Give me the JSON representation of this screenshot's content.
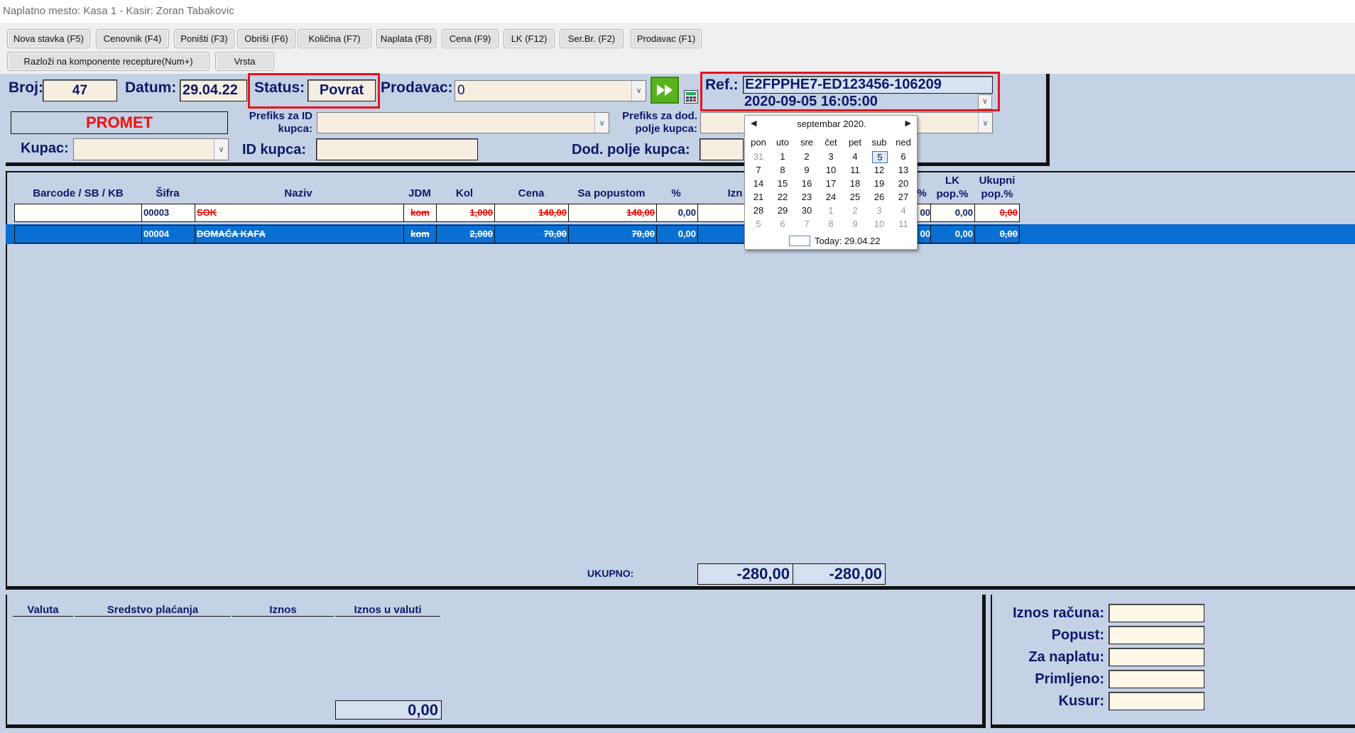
{
  "window": {
    "title": "Naplatno mesto: Kasa 1 - Kasir: Zoran Tabakovic"
  },
  "toolbar": {
    "buttons": [
      "Nova stavka (F5)",
      "Cenovnik (F4)",
      "Poništi (F3)",
      "Obriši (F6)",
      "Količina (F7)",
      "Naplata (F8)",
      "Cena (F9)",
      "LK (F12)",
      "Ser.Br. (F2)",
      "Prodavac (F1)"
    ],
    "row2": [
      "Razloži na komponente recepture(Num+)",
      "Vrsta"
    ]
  },
  "header": {
    "broj_label": "Broj:",
    "broj": "47",
    "datum_label": "Datum:",
    "datum": "29.04.22",
    "status_label": "Status:",
    "status": "Povrat",
    "prodavac_label": "Prodavac:",
    "prodavac": "0",
    "ref_label": "Ref.:",
    "ref": "E2FPPHE7-ED123456-106209",
    "ref_datetime": "2020-09-05 16:05:00",
    "promet": "PROMET",
    "prefiks_id_label1": "Prefiks za ID",
    "prefiks_id_label2": "kupca:",
    "prefiks_dod_label1": "Prefiks za dod.",
    "prefiks_dod_label2": "polje kupca:",
    "kupac_label": "Kupac:",
    "id_kupca_label": "ID kupca:",
    "dod_polje_label": "Dod. polje kupca:"
  },
  "grid": {
    "columns": [
      "Barcode / SB / KB",
      "Šifra",
      "Naziv",
      "JDM",
      "Kol",
      "Cena",
      "Sa popustom",
      "%",
      "Izn",
      "%",
      "LK pop.%",
      "Ukupni pop.%"
    ],
    "rows": [
      {
        "barcode": "",
        "sifra": "00003",
        "naziv": "SOK",
        "jdm": "kom",
        "kol": "1,000",
        "cena": "140,00",
        "sa_popustom": "140,00",
        "pct": "0,00",
        "col_pct": "00",
        "lk": "0,00",
        "ukupni": "0,00"
      },
      {
        "barcode": "",
        "sifra": "00004",
        "naziv": "DOMAĆA KAFA",
        "jdm": "kom",
        "kol": "2,000",
        "cena": "70,00",
        "sa_popustom": "70,00",
        "pct": "0,00",
        "col_pct": "00",
        "lk": "0,00",
        "ukupni": "0,00"
      }
    ],
    "ukupno_label": "UKUPNO:",
    "ukupno1": "-280,00",
    "ukupno2": "-280,00"
  },
  "calendar": {
    "month": "septembar 2020.",
    "days": [
      "pon",
      "uto",
      "sre",
      "čet",
      "pet",
      "sub",
      "ned"
    ],
    "weeks": [
      [
        "31",
        "1",
        "2",
        "3",
        "4",
        "5",
        "6"
      ],
      [
        "7",
        "8",
        "9",
        "10",
        "11",
        "12",
        "13"
      ],
      [
        "14",
        "15",
        "16",
        "17",
        "18",
        "19",
        "20"
      ],
      [
        "21",
        "22",
        "23",
        "24",
        "25",
        "26",
        "27"
      ],
      [
        "28",
        "29",
        "30",
        "1",
        "2",
        "3",
        "4"
      ],
      [
        "5",
        "6",
        "7",
        "8",
        "9",
        "10",
        "11"
      ]
    ],
    "today": "Today: 29.04.22"
  },
  "payments": {
    "columns": [
      "Valuta",
      "Sredstvo plaćanja",
      "Iznos",
      "Iznos u valuti"
    ],
    "total": "0,00"
  },
  "summary": {
    "iznos_racuna": "Iznos računa:",
    "popust": "Popust:",
    "za_naplatu": "Za naplatu:",
    "primljeno": "Primljeno:",
    "kusur": "Kusur:"
  },
  "icons": [
    "fast-forward-icon",
    "calculator-icon",
    "chevron-down-icon",
    "chevron-left-icon",
    "chevron-right-icon"
  ],
  "colors": {
    "panel": "#c5d1e4",
    "accent": "#e8121c",
    "selected": "#0a6fd2",
    "text": "#0a1a6a"
  }
}
